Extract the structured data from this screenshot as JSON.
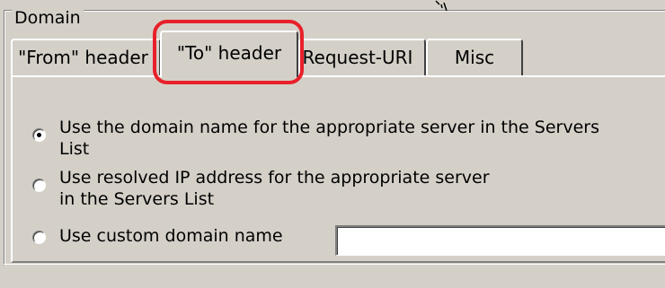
{
  "groupbox": {
    "title": "Domain"
  },
  "tabs": [
    {
      "label": "\"From\" header"
    },
    {
      "label": "\"To\" header",
      "selected": true
    },
    {
      "label": "Request-URI"
    },
    {
      "label": "Misc"
    }
  ],
  "highlight_color": "#e8202a",
  "options": [
    {
      "label_line1": "Use the domain name for the appropriate server in the Servers",
      "label_line2": "List",
      "checked": true
    },
    {
      "label_line1": "Use resolved IP address for the appropriate server",
      "label_line2": "in the Servers List",
      "checked": false
    },
    {
      "label": "Use custom domain name",
      "checked": false
    }
  ],
  "custom_domain": {
    "value": ""
  }
}
